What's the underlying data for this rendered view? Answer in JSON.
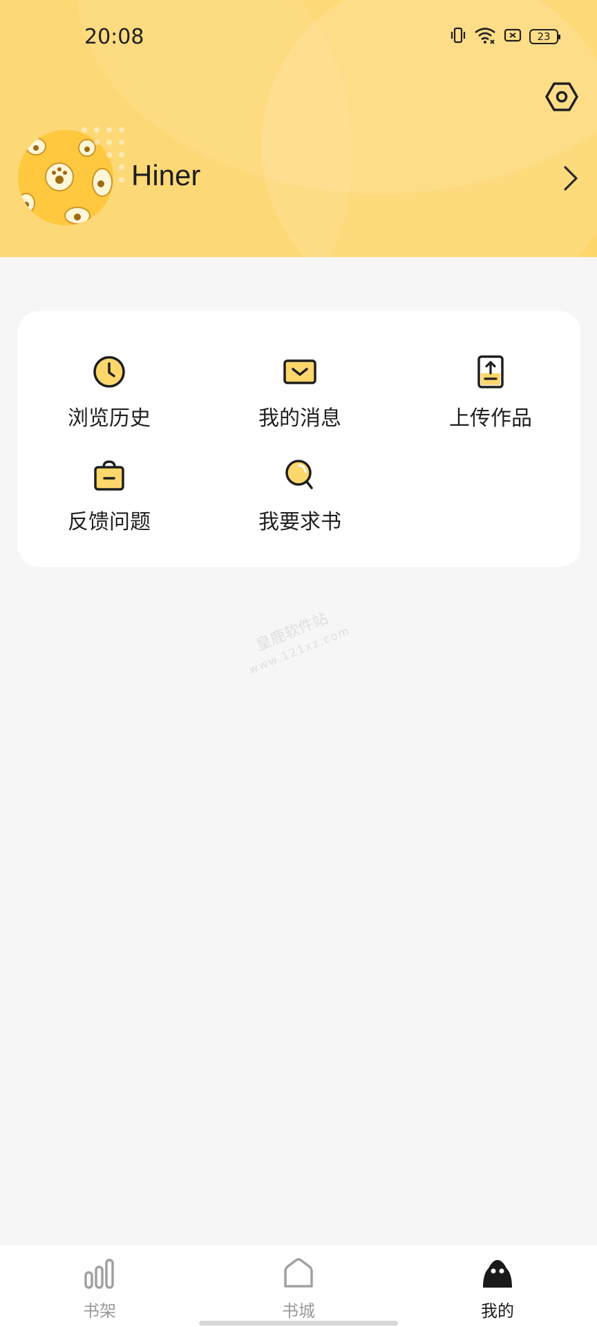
{
  "status_bar": {
    "time": "20:08",
    "battery": "23",
    "icons": [
      "vibrate-icon",
      "wifi-icon",
      "sim-off-icon",
      "battery-icon"
    ]
  },
  "header": {
    "settings_icon": "settings-hexagon-icon",
    "username": "Hiner",
    "chevron_icon": "chevron-right-icon"
  },
  "menu": {
    "items": [
      {
        "label": "浏览历史",
        "icon": "clock-icon"
      },
      {
        "label": "我的消息",
        "icon": "mail-icon"
      },
      {
        "label": "上传作品",
        "icon": "upload-icon"
      },
      {
        "label": "反馈问题",
        "icon": "bag-icon"
      },
      {
        "label": "我要求书",
        "icon": "search-icon"
      }
    ]
  },
  "watermark": {
    "line1": "皇鹿软件站",
    "line2": "www.121xz.com"
  },
  "bottom_nav": {
    "items": [
      {
        "label": "书架",
        "icon": "bookshelf-icon",
        "active": false
      },
      {
        "label": "书城",
        "icon": "home-icon",
        "active": false
      },
      {
        "label": "我的",
        "icon": "profile-icon",
        "active": true
      }
    ]
  },
  "colors": {
    "header_bg": "#fdd66c",
    "accent": "#fcc639",
    "card_bg": "#ffffff",
    "page_bg": "#f6f6f6"
  }
}
